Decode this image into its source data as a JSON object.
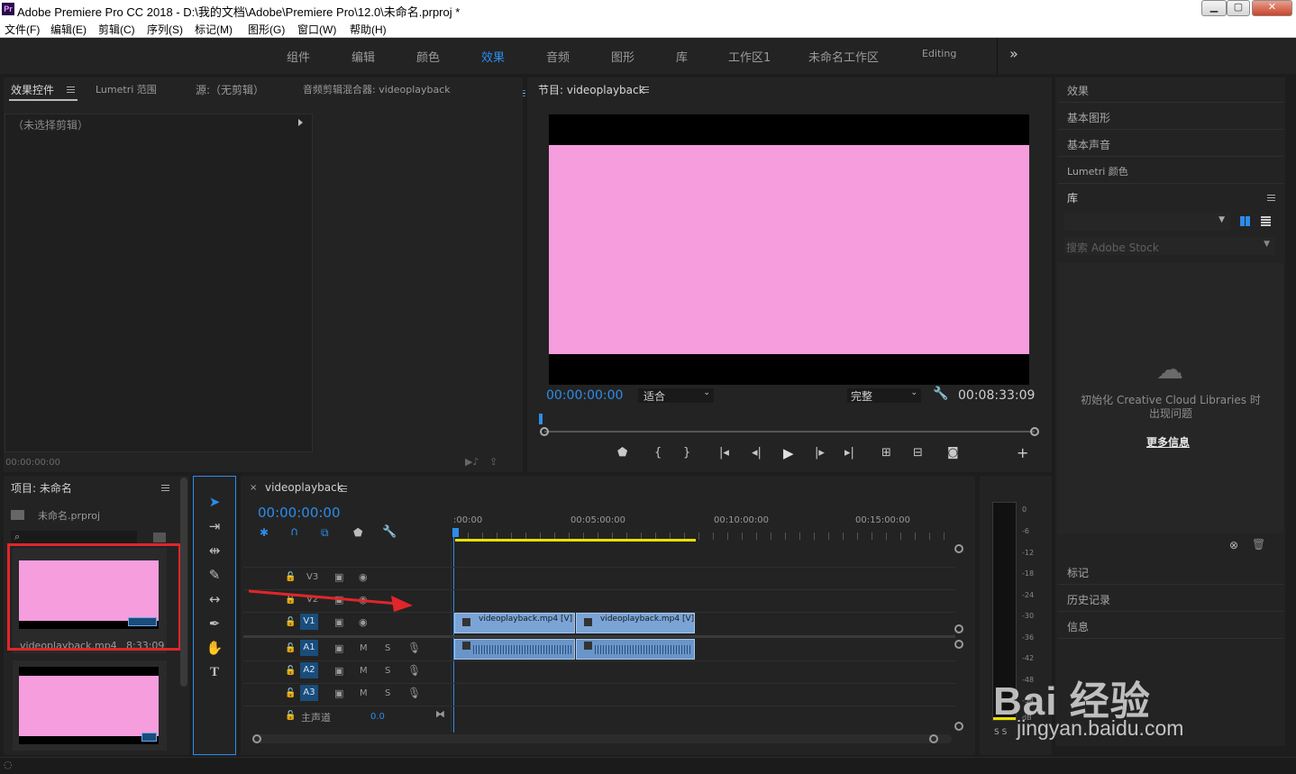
{
  "window": {
    "logo": "Pr",
    "title": "Adobe Premiere Pro CC 2018 - D:\\我的文档\\Adobe\\Premiere Pro\\12.0\\未命名.prproj *",
    "minimize": "▁",
    "maximize": "▢",
    "close": "✕"
  },
  "menu": [
    "文件(F)",
    "编辑(E)",
    "剪辑(C)",
    "序列(S)",
    "标记(M)",
    "图形(G)",
    "窗口(W)",
    "帮助(H)"
  ],
  "workspaces": [
    "组件",
    "编辑",
    "颜色",
    "效果",
    "音频",
    "图形",
    "库",
    "工作区1",
    "未命名工作区",
    "Editing"
  ],
  "workspace_active": "效果",
  "workspace_more": "»",
  "source_panel": {
    "tabs": [
      "效果控件",
      "Lumetri 范围",
      "源:（无剪辑）",
      "音频剪辑混合器: videoplayback"
    ],
    "no_clip": "（未选择剪辑）",
    "timecode": "00:00:00:00"
  },
  "program_monitor": {
    "title": "节目: videoplayback",
    "timecode": "00:00:00:00",
    "fit": "适合",
    "quality": "完整",
    "duration": "00:08:33:09",
    "video_color": "#f59ddd"
  },
  "right_panel": {
    "items_top": [
      "效果",
      "基本图形",
      "基本声音",
      "Lumetri 颜色"
    ],
    "library_title": "库",
    "search_placeholder": "搜索 Adobe Stock",
    "cc_message": "初始化 Creative Cloud Libraries 时出现问题",
    "more_info": "更多信息",
    "items_bottom": [
      "标记",
      "历史记录",
      "信息"
    ]
  },
  "project_panel": {
    "title": "项目: 未命名",
    "project_file": "未命名.prproj",
    "search_icon": "⌕",
    "items": [
      {
        "name": "videoplayback.mp4",
        "duration": "8:33:09"
      }
    ]
  },
  "timeline": {
    "sequence": "videoplayback",
    "timecode": "00:00:00:00",
    "ruler": [
      ":00:00",
      "00:05:00:00",
      "00:10:00:00",
      "00:15:00:00"
    ],
    "video_tracks": [
      "V3",
      "V2",
      "V1"
    ],
    "audio_tracks": [
      "A1",
      "A2",
      "A3"
    ],
    "master": "主声道",
    "master_value": "0.0",
    "mute": "M",
    "solo": "S",
    "clips_video": [
      "videoplayback.mp4 [V]",
      "videoplayback.mp4 [V]"
    ]
  },
  "meters": {
    "scale": [
      "0",
      "-6",
      "-12",
      "-18",
      "-24",
      "-30",
      "-36",
      "-42",
      "-48",
      "-54",
      "dB"
    ],
    "solo_buttons": "S S"
  },
  "watermark": {
    "brand": "Bai 经验",
    "url": "jingyan.baidu.com"
  },
  "colors": {
    "accent": "#2d8ceb",
    "clip": "#7aa4d6",
    "work_area": "#e8e000",
    "annotation": "#e0262a"
  }
}
